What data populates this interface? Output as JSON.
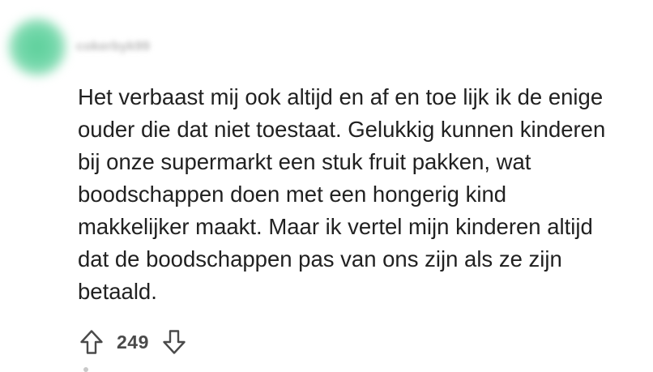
{
  "comment": {
    "author": "cokerbyk99",
    "body_lines": [
      "Het verbaast mij ook altijd en af en toe lijk ik de enige",
      "ouder die dat niet toestaat. Gelukkig kunnen kinderen",
      "bij onze supermarkt een stuk fruit pakken, wat",
      "boodschappen doen met een hongerig kind",
      "makkelijker maakt. Maar ik vertel mijn kinderen altijd",
      "dat de boodschappen pas van ons zijn als ze zijn",
      "betaald."
    ],
    "score": "249",
    "avatar_color": "#5ccf9a"
  },
  "icons": {
    "upvote": "upvote-arrow-icon",
    "downvote": "downvote-arrow-icon"
  }
}
